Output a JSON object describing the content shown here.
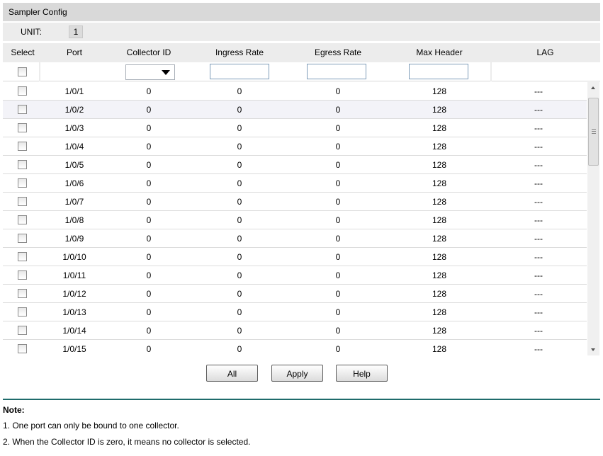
{
  "title": "Sampler Config",
  "unit": {
    "label": "UNIT:",
    "value": "1"
  },
  "columns": [
    "Select",
    "Port",
    "Collector ID",
    "Ingress Rate",
    "Egress Rate",
    "Max Header",
    "LAG"
  ],
  "rows": [
    {
      "port": "1/0/1",
      "collector_id": "0",
      "ingress": "0",
      "egress": "0",
      "max_header": "128",
      "lag": "---"
    },
    {
      "port": "1/0/2",
      "collector_id": "0",
      "ingress": "0",
      "egress": "0",
      "max_header": "128",
      "lag": "---"
    },
    {
      "port": "1/0/3",
      "collector_id": "0",
      "ingress": "0",
      "egress": "0",
      "max_header": "128",
      "lag": "---"
    },
    {
      "port": "1/0/4",
      "collector_id": "0",
      "ingress": "0",
      "egress": "0",
      "max_header": "128",
      "lag": "---"
    },
    {
      "port": "1/0/5",
      "collector_id": "0",
      "ingress": "0",
      "egress": "0",
      "max_header": "128",
      "lag": "---"
    },
    {
      "port": "1/0/6",
      "collector_id": "0",
      "ingress": "0",
      "egress": "0",
      "max_header": "128",
      "lag": "---"
    },
    {
      "port": "1/0/7",
      "collector_id": "0",
      "ingress": "0",
      "egress": "0",
      "max_header": "128",
      "lag": "---"
    },
    {
      "port": "1/0/8",
      "collector_id": "0",
      "ingress": "0",
      "egress": "0",
      "max_header": "128",
      "lag": "---"
    },
    {
      "port": "1/0/9",
      "collector_id": "0",
      "ingress": "0",
      "egress": "0",
      "max_header": "128",
      "lag": "---"
    },
    {
      "port": "1/0/10",
      "collector_id": "0",
      "ingress": "0",
      "egress": "0",
      "max_header": "128",
      "lag": "---"
    },
    {
      "port": "1/0/11",
      "collector_id": "0",
      "ingress": "0",
      "egress": "0",
      "max_header": "128",
      "lag": "---"
    },
    {
      "port": "1/0/12",
      "collector_id": "0",
      "ingress": "0",
      "egress": "0",
      "max_header": "128",
      "lag": "---"
    },
    {
      "port": "1/0/13",
      "collector_id": "0",
      "ingress": "0",
      "egress": "0",
      "max_header": "128",
      "lag": "---"
    },
    {
      "port": "1/0/14",
      "collector_id": "0",
      "ingress": "0",
      "egress": "0",
      "max_header": "128",
      "lag": "---"
    },
    {
      "port": "1/0/15",
      "collector_id": "0",
      "ingress": "0",
      "egress": "0",
      "max_header": "128",
      "lag": "---"
    }
  ],
  "buttons": {
    "all": "All",
    "apply": "Apply",
    "help": "Help"
  },
  "note": {
    "title": "Note:",
    "lines": [
      "1. One port can only be bound to one collector.",
      "2. When the Collector ID is zero, it means no collector is selected."
    ]
  },
  "colors": {
    "title_bg": "#d9d9d9",
    "header_bg": "#ececec",
    "divider": "#1f6b6b"
  }
}
